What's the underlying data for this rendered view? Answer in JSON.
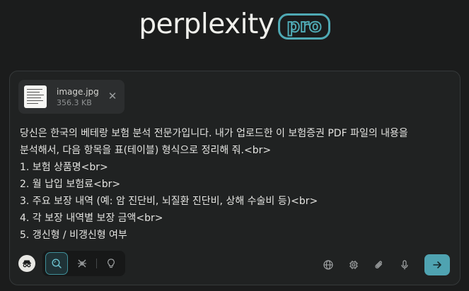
{
  "logo": {
    "word": "perplexity",
    "badge": "pro"
  },
  "attachment": {
    "file_name": "image.jpg",
    "file_size": "356.3 KB",
    "remove_icon": "close-icon"
  },
  "prompt": {
    "lines": [
      "당신은 한국의 베테랑 보험 분석 전문가입니다. 내가 업로드한 이 보험증권 PDF 파일의 내용을",
      "분석해서, 다음 항목을 표(테이블) 형식으로 정리해 줘.<br>",
      "1. 보험 상품명<br>",
      "2. 월 납입 보험료<br>",
      "3. 주요 보장 내역 (예: 암 진단비, 뇌질환 진단비, 상해 수술비 등)<br>",
      "4. 각 보장 내역별 보장 금액<br>",
      "5. 갱신형 / 비갱신형 여부"
    ]
  },
  "toolbar": {
    "left_icons": [
      "incognito-icon",
      "search-icon",
      "research-icon",
      "lightbulb-icon"
    ],
    "right_icons": [
      "globe-icon",
      "chip-icon",
      "paperclip-icon",
      "microphone-icon"
    ],
    "send_icon": "arrow-right-icon"
  },
  "colors": {
    "background": "#1b1c1c",
    "card": "#202222",
    "accent": "#4fa3b1",
    "spellcheck": "#d9534f"
  }
}
